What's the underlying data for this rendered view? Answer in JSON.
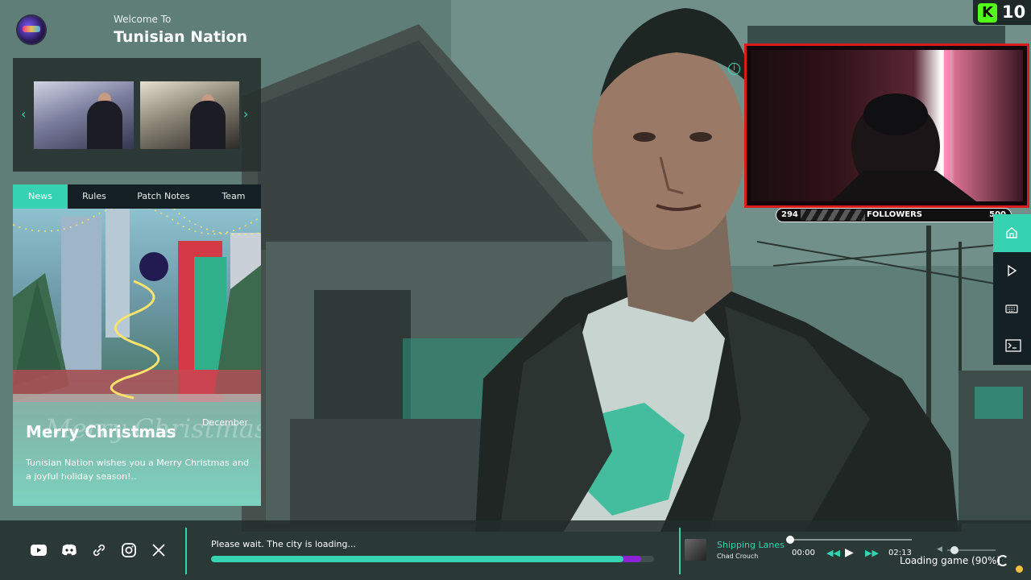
{
  "header": {
    "welcome": "Welcome To",
    "title": "Tunisian Nation"
  },
  "gallery": {
    "prev_icon": "chevron-left-icon",
    "next_icon": "chevron-right-icon"
  },
  "tabs": [
    {
      "label": "News",
      "active": true
    },
    {
      "label": "Rules",
      "active": false
    },
    {
      "label": "Patch Notes",
      "active": false
    },
    {
      "label": "Team",
      "active": false
    }
  ],
  "news": {
    "month": "December",
    "title": "Merry Christmas",
    "script_overlay": "Merry Christmas",
    "body": "Tunisian Nation wishes you a Merry Christmas and a joyful holiday season!.."
  },
  "badge": {
    "icon": "kick-icon",
    "value": "10",
    "color": "#53fc18"
  },
  "followers": {
    "current": "294",
    "label": "FOLLOWERS",
    "goal": "500"
  },
  "right_nav": [
    "home-icon",
    "play-icon",
    "keyboard-icon",
    "terminal-icon"
  ],
  "social": [
    "youtube-icon",
    "discord-icon",
    "link-icon",
    "instagram-icon",
    "x-icon"
  ],
  "loading": {
    "text": "Please wait. The city is loading...",
    "progress": 0.97
  },
  "music": {
    "song": "Shipping Lanes",
    "artist": "Chad Crouch",
    "time_current": "00:00",
    "time_end": "02:13",
    "position": 0.0,
    "volume": 0.15
  },
  "status": {
    "loading_game": "Loading game (90%)"
  },
  "colors": {
    "accent": "#35d3b1",
    "panel": "#142023",
    "webcam_border": "#d91b1b",
    "progress_tip": "#8a24d6"
  }
}
